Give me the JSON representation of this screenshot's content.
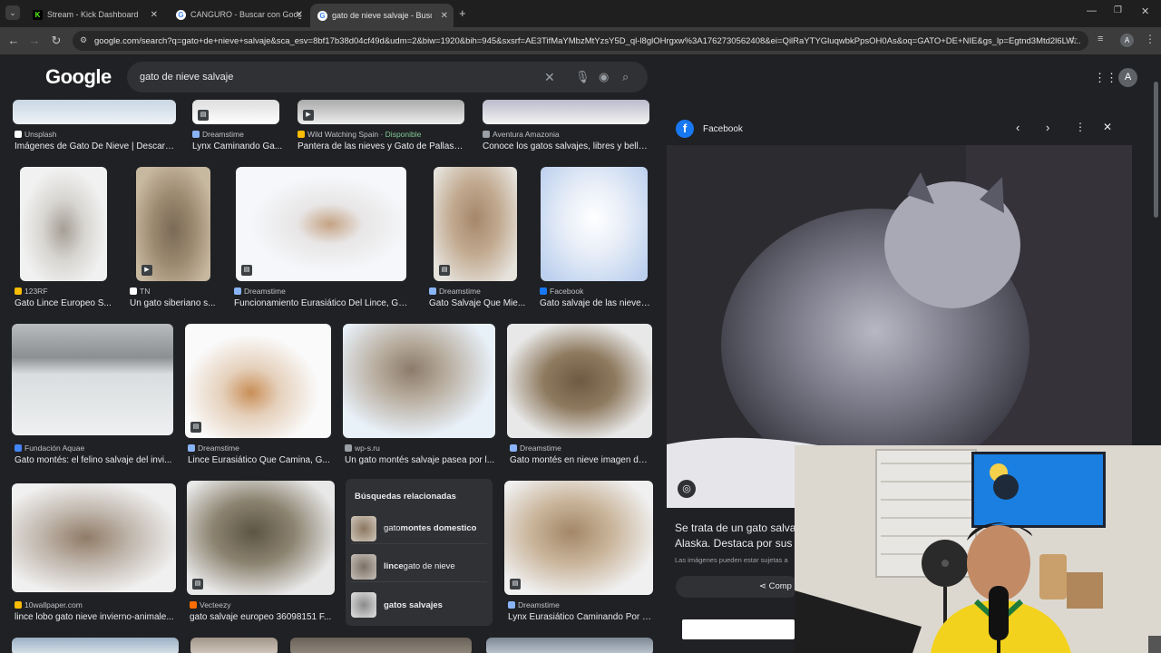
{
  "tabs": [
    {
      "title": "Stream - Kick Dashboard",
      "favicon": "K",
      "color": "#53fc18"
    },
    {
      "title": "CANGURO - Buscar con Google",
      "favicon": "G",
      "color": "#4285f4"
    },
    {
      "title": "gato de nieve salvaje - Buscar c",
      "favicon": "G",
      "color": "#4285f4"
    }
  ],
  "url": "google.com/search?q=gato+de+nieve+salvaje&sca_esv=8bf17b38d04cf49d&udm=2&biw=1920&bih=945&sxsrf=AE3TifMaYMbzMtYzsY5D_ql-l8glOHrgxw%3A1762730562408&ei=QilRaYTYGluqwbkPpsOH0As&oq=GATO+DE+NIE&gs_lp=Egtnd3Mtd2l6LW...",
  "logo": "Google",
  "search_query": "gato de nieve salvaje",
  "profile_initial": "A",
  "results": [
    {
      "source": "Unsplash",
      "title": "Imágenes de Gato De Nieve | Descarg...",
      "icon": "#ffffff"
    },
    {
      "source": "Dreamstime",
      "title": "Lynx Caminando Ga...",
      "icon": "#8ab4f8"
    },
    {
      "source": "Wild Watching Spain",
      "extra": "Disponible",
      "title": "Pantera de las nieves y Gato de Pallas e...",
      "icon": "#fbbc04"
    },
    {
      "source": "Aventura Amazonia",
      "title": "Conoce los gatos salvajes, libres y bellos...",
      "icon": "#9aa0a6"
    },
    {
      "source": "123RF",
      "title": "Gato Lince Europeo S...",
      "icon": "#fbbc04"
    },
    {
      "source": "TN",
      "title": "Un gato siberiano s...",
      "icon": "#ffffff"
    },
    {
      "source": "Dreamstime",
      "title": "Funcionamiento Eurasiático Del Lince, Gat...",
      "icon": "#8ab4f8"
    },
    {
      "source": "Dreamstime",
      "title": "Gato Salvaje Que Mie...",
      "icon": "#8ab4f8"
    },
    {
      "source": "Facebook",
      "title": "Gato salvaje de las nieves...",
      "icon": "#1877f2"
    },
    {
      "source": "Fundación Aquae",
      "title": "Gato montés: el felino salvaje del invi...",
      "icon": "#4285f4"
    },
    {
      "source": "Dreamstime",
      "title": "Lince Eurasiático Que Camina, G...",
      "icon": "#8ab4f8"
    },
    {
      "source": "wp-s.ru",
      "title": "Un gato montés salvaje pasea por l...",
      "icon": "#9aa0a6"
    },
    {
      "source": "Dreamstime",
      "title": "Gato montés en nieve imagen de ...",
      "icon": "#8ab4f8"
    },
    {
      "source": "10wallpaper.com",
      "title": "lince lobo gato nieve invierno-animale...",
      "icon": "#fbbc04"
    },
    {
      "source": "Vecteezy",
      "title": "gato salvaje europeo 36098151 F...",
      "icon": "#ff6d00"
    },
    {
      "source": "Dreamstime",
      "title": "Lynx Eurasiático Caminando Por L...",
      "icon": "#8ab4f8"
    }
  ],
  "related": {
    "heading": "Búsquedas relacionadas",
    "items": [
      {
        "normal": "gato ",
        "bold": "montes domestico"
      },
      {
        "bold": "lince",
        "normal": " gato de nieve"
      },
      {
        "bold": "gatos salvajes",
        "normal": ""
      }
    ]
  },
  "panel": {
    "source": "Facebook",
    "description": "Se trata de un gato salva",
    "description2": "Alaska. Destaca por sus g",
    "notice": "Las imágenes pueden estar sujetas a",
    "share": "Comp"
  }
}
